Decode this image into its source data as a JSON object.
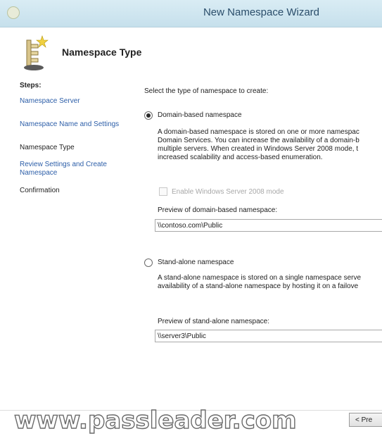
{
  "window": {
    "title": "New Namespace Wizard"
  },
  "header": {
    "title": "Namespace Type"
  },
  "steps": {
    "heading": "Steps:",
    "items": [
      {
        "label": "Namespace Server",
        "state": "link"
      },
      {
        "label": "Namespace Name and Settings",
        "state": "link"
      },
      {
        "label": "Namespace Type",
        "state": "current"
      },
      {
        "label": "Review Settings and Create Namespace",
        "state": "link"
      },
      {
        "label": "Confirmation",
        "state": "plain"
      }
    ]
  },
  "content": {
    "instruction": "Select the type of namespace to create:",
    "domain_option": {
      "label": "Domain-based namespace",
      "selected": true,
      "description": [
        "A domain-based namespace is stored on one or more namespac",
        "Domain Services. You can increase the availability of a domain-b",
        "multiple servers. When created in Windows Server 2008 mode, t",
        "increased scalability and access-based enumeration."
      ],
      "mode_checkbox_label": "Enable Windows Server 2008 mode",
      "preview_label": "Preview of domain-based namespace:",
      "preview_value": "\\\\contoso.com\\Public"
    },
    "standalone_option": {
      "label": "Stand-alone namespace",
      "selected": false,
      "description": [
        "A stand-alone namespace is stored on a single namespace serve",
        "availability of a stand-alone namespace by hosting it on a failove"
      ],
      "preview_label": "Preview of stand-alone namespace:",
      "preview_value": "\\\\server3\\Public"
    }
  },
  "footer": {
    "previous_label": "< Pre",
    "watermark": "www.passleader.com"
  }
}
